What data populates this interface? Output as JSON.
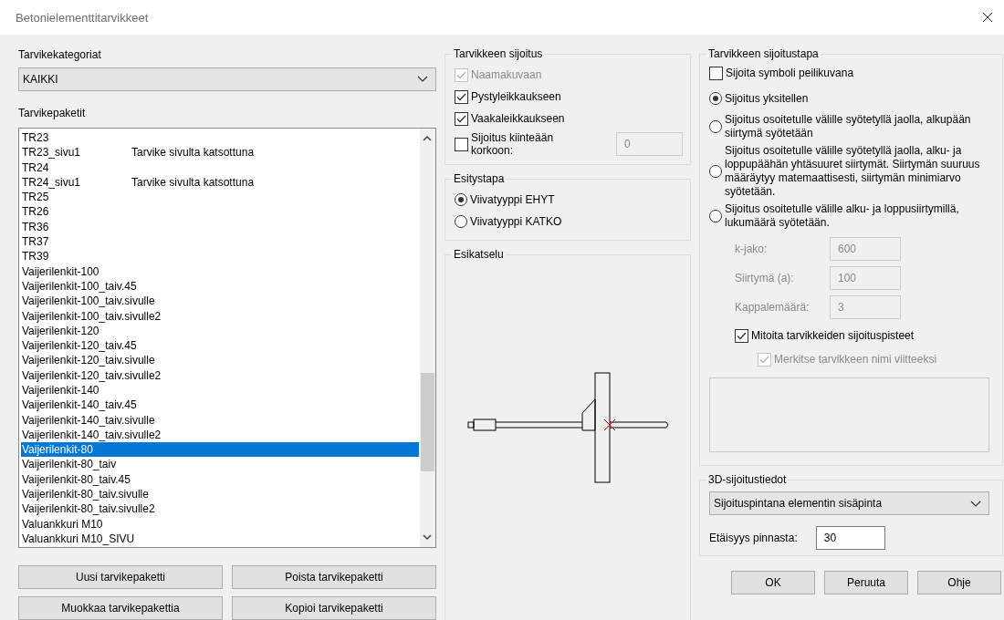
{
  "window": {
    "title": "Betonielementtitarvikkeet"
  },
  "categories": {
    "label": "Tarvikekategoriat",
    "value": "KAIKKI"
  },
  "packages": {
    "label": "Tarvikepaketit",
    "rows": [
      {
        "name": "TR23",
        "selected": false
      },
      {
        "name": "TR23_sivu1",
        "description": "Tarvike sivulta katsottuna",
        "selected": false
      },
      {
        "name": "TR24",
        "selected": false
      },
      {
        "name": "TR24_sivu1",
        "description": "Tarvike sivulta katsottuna",
        "selected": false
      },
      {
        "name": "TR25",
        "selected": false
      },
      {
        "name": "TR26",
        "selected": false
      },
      {
        "name": "TR36",
        "selected": false
      },
      {
        "name": "TR37",
        "selected": false
      },
      {
        "name": "TR39",
        "selected": false
      },
      {
        "name": "Vaijerilenkit-100",
        "selected": false
      },
      {
        "name": "Vaijerilenkit-100_taiv.45",
        "selected": false
      },
      {
        "name": "Vaijerilenkit-100_taiv.sivulle",
        "selected": false
      },
      {
        "name": "Vaijerilenkit-100_taiv.sivulle2",
        "selected": false
      },
      {
        "name": "Vaijerilenkit-120",
        "selected": false
      },
      {
        "name": "Vaijerilenkit-120_taiv.45",
        "selected": false
      },
      {
        "name": "Vaijerilenkit-120_taiv.sivulle",
        "selected": false
      },
      {
        "name": "Vaijerilenkit-120_taiv.sivulle2",
        "selected": false
      },
      {
        "name": "Vaijerilenkit-140",
        "selected": false
      },
      {
        "name": "Vaijerilenkit-140_taiv.45",
        "selected": false
      },
      {
        "name": "Vaijerilenkit-140_taiv.sivulle",
        "selected": false
      },
      {
        "name": "Vaijerilenkit-140_taiv.sivulle2",
        "selected": false
      },
      {
        "name": "Vaijerilenkit-80",
        "selected": true
      },
      {
        "name": "Vaijerilenkit-80_taiv",
        "selected": false
      },
      {
        "name": "Vaijerilenkit-80_taiv.45",
        "selected": false
      },
      {
        "name": "Vaijerilenkit-80_taiv.sivulle",
        "selected": false
      },
      {
        "name": "Vaijerilenkit-80_taiv.sivulle2",
        "selected": false
      },
      {
        "name": "Valuankkuri M10",
        "selected": false
      },
      {
        "name": "Valuankkuri M10_SIVU",
        "selected": false
      }
    ],
    "buttons": [
      "Uusi tarvikepaketti",
      "Poista tarvikepaketti",
      "Muokkaa tarvikepakettia",
      "Kopioi tarvikepaketti"
    ]
  },
  "placement": {
    "title": "Tarvikkeen sijoitus",
    "options": [
      {
        "label": "Naamakuvaan",
        "checked": true,
        "disabled": true
      },
      {
        "label": "Pystyleikkaukseen",
        "checked": true,
        "disabled": false
      },
      {
        "label": "Vaakaleikkaukseen",
        "checked": true,
        "disabled": false
      }
    ],
    "fixed_height": {
      "label": "Sijoitus kiinteään korkoon:",
      "checked": false,
      "value": "0",
      "disabled": true
    }
  },
  "presentation": {
    "title": "Esitystapa",
    "options": [
      {
        "label": "Viivatyyppi EHYT",
        "selected": true
      },
      {
        "label": "Viivatyyppi KATKO",
        "selected": false
      }
    ]
  },
  "preview": {
    "title": "Esikatselu"
  },
  "method": {
    "title": "Tarvikkeen sijoitustapa",
    "mirror": {
      "label": "Sijoita symboli peilikuvana",
      "checked": false
    },
    "options": [
      {
        "label": "Sijoitus yksitellen",
        "selected": true
      },
      {
        "label": "Sijoitus osoitetulle välille syötetyllä jaolla, alkupään siirtymä syötetään",
        "selected": false
      },
      {
        "label": "Sijoitus osoitetulle välille syötetyllä jaolla, alku- ja loppupäähän yhtäsuuret siirtymät. Siirtymän suuruus määräytyy matemaattisesti, siirtymän minimiarvo syötetään.",
        "selected": false
      },
      {
        "label": "Sijoitus osoitetulle välille alku- ja loppusiirtymillä, lukumäärä syötetään.",
        "selected": false
      }
    ],
    "fields": [
      {
        "label": "k-jako:",
        "value": "600",
        "disabled": true
      },
      {
        "label": "Siirtymä (a):",
        "value": "100",
        "disabled": true
      },
      {
        "label": "Kappalemäärä:",
        "value": "3",
        "disabled": true
      }
    ],
    "checks": [
      {
        "label": "Mitoita tarvikkeiden sijoituspisteet",
        "checked": true,
        "disabled": false
      },
      {
        "label": "Merkitse tarvikkeen nimi viitteeksi",
        "checked": true,
        "disabled": true
      }
    ]
  },
  "placement_3d": {
    "title": "3D-sijoitustiedot",
    "value": "Sijoituspintana elementin sisäpinta",
    "distance": {
      "label": "Etäisyys pinnasta:",
      "value": "30"
    }
  },
  "buttons": [
    "OK",
    "Peruuta",
    "Ohje"
  ]
}
